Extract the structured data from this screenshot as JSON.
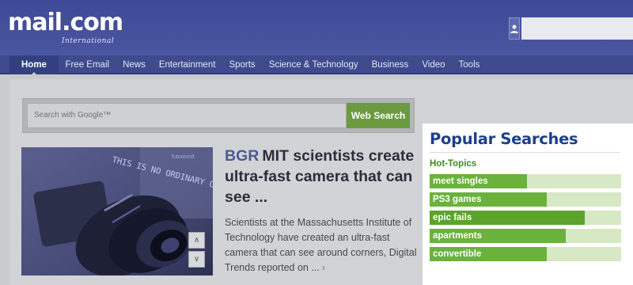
{
  "header": {
    "logo_text": "mail.com",
    "logo_sub": "International"
  },
  "nav": {
    "items": [
      "Home",
      "Free Email",
      "News",
      "Entertainment",
      "Sports",
      "Science & Technology",
      "Business",
      "Video",
      "Tools"
    ],
    "active": "Home"
  },
  "search": {
    "placeholder": "Search with Google™",
    "button_label": "Web Search"
  },
  "article": {
    "source": "BGR",
    "title": "MIT scientists create ultra-fast camera that can see ...",
    "body": "Scientists at the Massachusetts Institute of Technology have created an ultra-fast camera that can see around corners, Digital Trends reported on ...",
    "more_glyph": "›",
    "image_text": "THIS IS NO ORDINARY CAMERA",
    "image_watermark": "futurevolt"
  },
  "slider": {
    "up_glyph": "∧",
    "down_glyph": "∨"
  },
  "popular": {
    "title": "Popular Searches",
    "subtitle": "Hot-Topics",
    "items": [
      {
        "label": "meet singles",
        "level": 0.51
      },
      {
        "label": "PS3 games",
        "level": 0.61
      },
      {
        "label": "epic fails",
        "level": 0.81
      },
      {
        "label": "apartments",
        "level": 0.71
      },
      {
        "label": "convertible",
        "level": 0.61
      }
    ]
  },
  "colors": {
    "header_bg": "#4a56a0",
    "nav_bg": "#3e4a8c",
    "accent_green": "#6ab23c",
    "bar_track": "#d7e8c4",
    "popular_title": "#1e3f8a"
  }
}
